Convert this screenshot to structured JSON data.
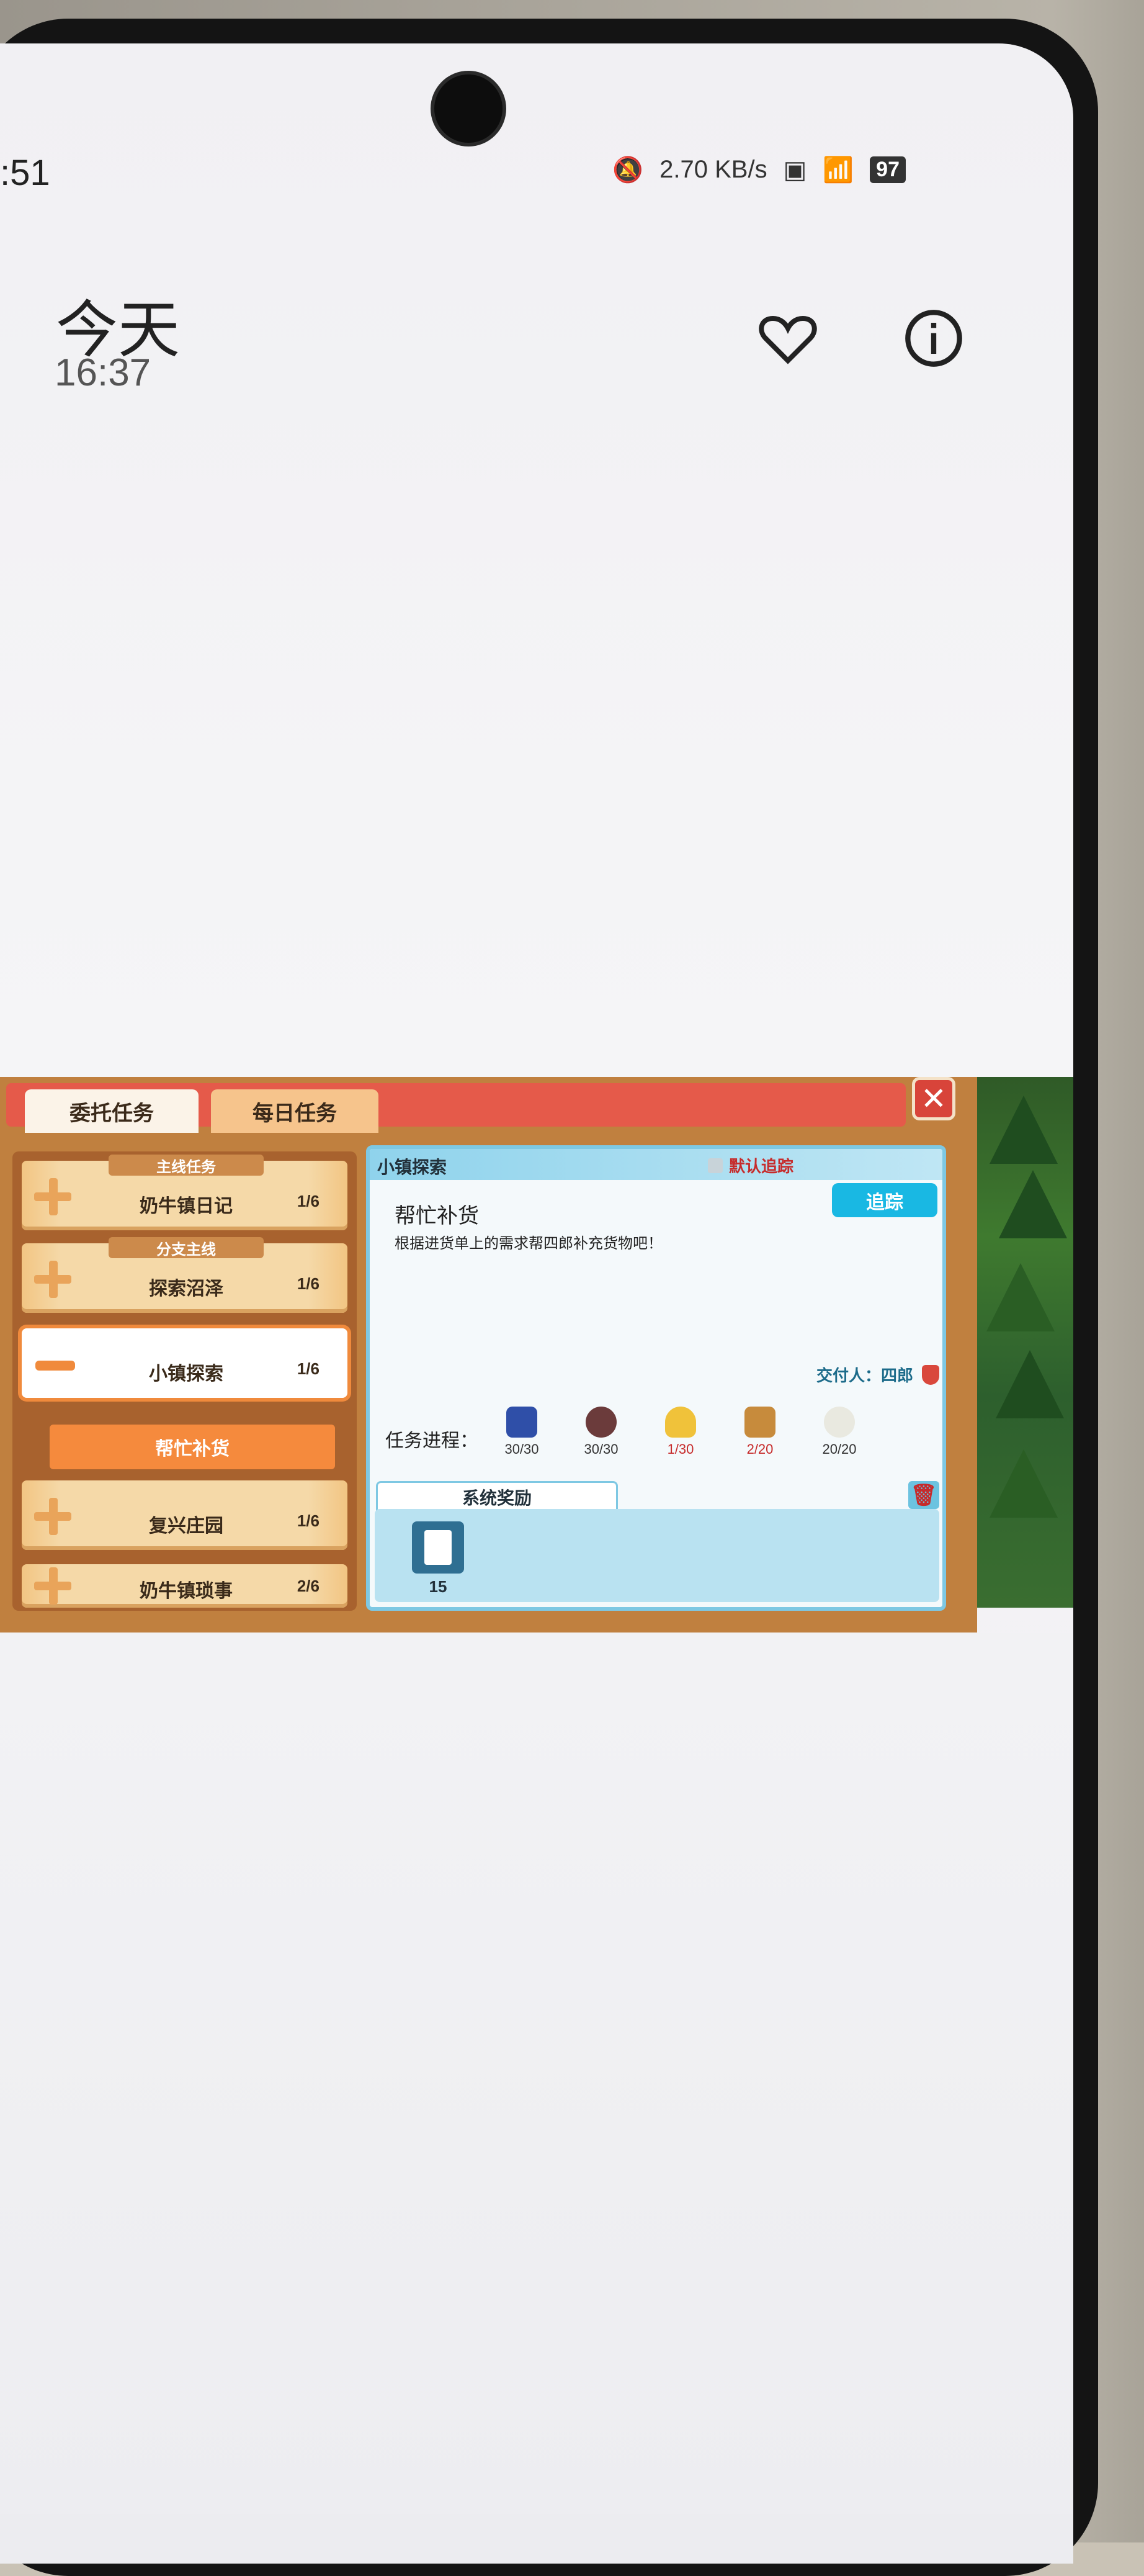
{
  "status_bar": {
    "time": ":51",
    "speed": "2.70 KB/s",
    "battery": "97"
  },
  "header": {
    "date_label": "今天",
    "time": "16:37"
  },
  "game": {
    "tabs": [
      "委托任务",
      "每日任务"
    ],
    "close": "✕",
    "quests": [
      {
        "tag": "主线任务",
        "name": "奶牛镇日记",
        "count": "1/6"
      },
      {
        "tag": "分支主线",
        "name": "探索沼泽",
        "count": "1/6"
      },
      {
        "tag": "",
        "name": "小镇探索",
        "count": "1/6"
      },
      {
        "tag": "",
        "name": "复兴庄园",
        "count": "1/6"
      },
      {
        "tag": "",
        "name": "奶牛镇琐事",
        "count": "2/6"
      }
    ],
    "subtask": "帮忙补货",
    "detail": {
      "title": "小镇探索",
      "default_track": "默认追踪",
      "track_button": "追踪",
      "task_name": "帮忙补货",
      "task_desc": "根据进货单上的需求帮四郎补充货物吧！",
      "giver": "交付人：四郎",
      "progress_label": "任务进程：",
      "items": [
        {
          "count": "30/30",
          "color": "#2f4fa8"
        },
        {
          "count": "30/30",
          "color": "#6b3b3b"
        },
        {
          "count": "1/30",
          "color": "#f0c23a"
        },
        {
          "count": "2/20",
          "color": "#c78b3c"
        },
        {
          "count": "20/20",
          "color": "#e9e9e0"
        }
      ],
      "reward_tab": "系统奖励",
      "reward_qty": "15"
    }
  }
}
